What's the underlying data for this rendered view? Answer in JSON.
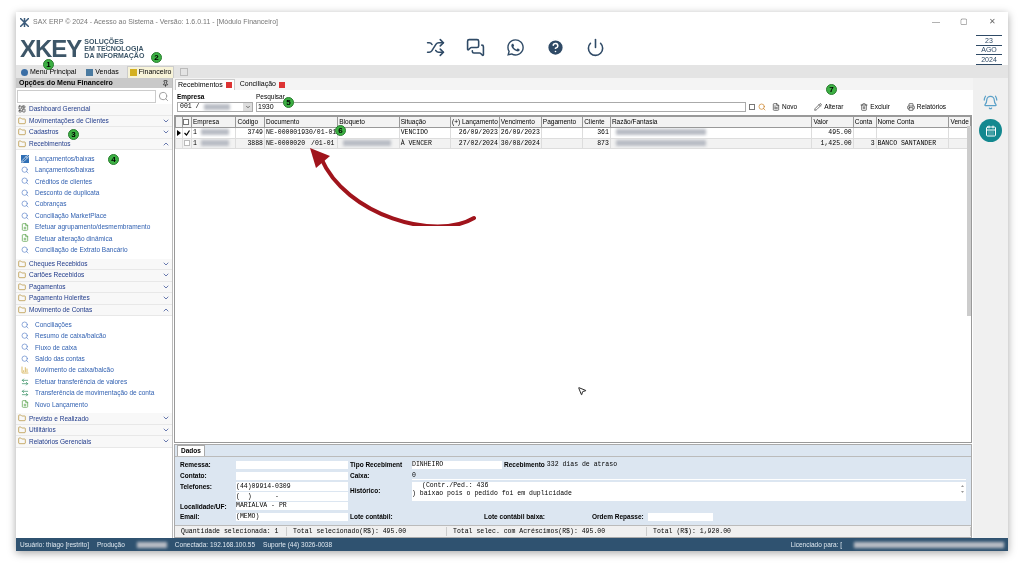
{
  "window": {
    "title": "SAX ERP © 2024 - Acesso ao Sistema - Versão: 1.6.0.11 - [Módulo Financeiro]",
    "controls": [
      "—",
      "▢",
      "✕"
    ]
  },
  "logo": {
    "mark": "XKEY",
    "tagline": [
      "SOLUÇÕES",
      "EM TECNOLOGIA",
      "DA INFORMAÇÃO"
    ]
  },
  "date": {
    "day": "23",
    "month": "AGO",
    "year": "2024"
  },
  "module_tabs": [
    {
      "label": "Menu Principal",
      "selected": false
    },
    {
      "label": "Vendas",
      "selected": false
    },
    {
      "label": "Financeiro",
      "selected": true
    }
  ],
  "sidebar": {
    "title": "Opções do Menu Financeiro",
    "items": [
      {
        "label": "Dashboard Gerencial",
        "kind": "link"
      },
      {
        "label": "Movimentações de Clientes",
        "kind": "section",
        "expanded": false
      },
      {
        "label": "Cadastros",
        "kind": "section",
        "expanded": false
      },
      {
        "label": "Recebimentos",
        "kind": "section",
        "expanded": true,
        "children": [
          {
            "label": "Lançamentos/baixas",
            "kind": "edit"
          },
          {
            "label": "Lançamentos/baixas",
            "kind": "search"
          },
          {
            "label": "Créditos de clientes",
            "kind": "search"
          },
          {
            "label": "Desconto de duplicata",
            "kind": "search"
          },
          {
            "label": "Cobranças",
            "kind": "search"
          },
          {
            "label": "Conciliação MarketPlace",
            "kind": "search"
          },
          {
            "label": "Efetuar agrupamento/desmembramento",
            "kind": "doc"
          },
          {
            "label": "Efetuar alteração dinâmica",
            "kind": "doc"
          },
          {
            "label": "Conciliação de Extrato Bancário",
            "kind": "search"
          }
        ]
      },
      {
        "label": "Cheques Recebidos",
        "kind": "section",
        "expanded": false
      },
      {
        "label": "Cartões Recebidos",
        "kind": "section",
        "expanded": false
      },
      {
        "label": "Pagamentos",
        "kind": "section",
        "expanded": false
      },
      {
        "label": "Pagamento Holerites",
        "kind": "section",
        "expanded": false
      },
      {
        "label": "Movimento de Contas",
        "kind": "section",
        "expanded": true,
        "children": [
          {
            "label": "Conciliações",
            "kind": "search"
          },
          {
            "label": "Resumo de caixa/balcão",
            "kind": "search"
          },
          {
            "label": "Fluxo de caixa",
            "kind": "search"
          },
          {
            "label": "Saldo das contas",
            "kind": "search"
          },
          {
            "label": "Movimento de caixa/balcão",
            "kind": "chart"
          },
          {
            "label": "Efetuar transferência de valores",
            "kind": "transfer"
          },
          {
            "label": "Transferência de movimentação de conta",
            "kind": "transfer"
          },
          {
            "label": "Novo Lançamento",
            "kind": "doc"
          }
        ]
      },
      {
        "label": "Previsto e Realizado",
        "kind": "section",
        "expanded": false
      },
      {
        "label": "Utilitários",
        "kind": "section",
        "expanded": false
      },
      {
        "label": "Relatórios Gerenciais",
        "kind": "section",
        "expanded": false
      }
    ]
  },
  "doc_tabs": [
    {
      "label": "Recebimentos",
      "selected": true
    },
    {
      "label": "Conciliação",
      "selected": false
    }
  ],
  "filters": {
    "empresa_label": "Empresa",
    "empresa_value": "001 /",
    "search_label": "Pesquisar",
    "search_value": "1930",
    "exact_checked": false
  },
  "toolbar": [
    "Novo",
    "Alterar",
    "Excluir",
    "Relatórios"
  ],
  "table": {
    "columns": [
      "Empresa",
      "Código",
      "Documento",
      "Bloqueto",
      "Situação",
      "(+) Lançamento",
      "Vencimento",
      "Pagamento",
      "Cliente",
      "Razão/Fantasia",
      "Valor",
      "Conta",
      "Nome Conta",
      "Vende"
    ],
    "all_checked": false,
    "rows": [
      {
        "current": true,
        "checked": true,
        "empresa": "1",
        "codigo": "3749",
        "documento": "NE-000001930/01-01",
        "documento_end": "",
        "situacao": "VENCIDO",
        "lancamento": "26/09/2023",
        "vencimento": "26/09/2023",
        "cliente": "361",
        "valor": "495.00",
        "conta": "",
        "nome_conta": ""
      },
      {
        "current": false,
        "checked": false,
        "empresa": "1",
        "codigo": "3888",
        "documento": "NE-0000020",
        "documento_end": "/01-01",
        "situacao": "À VENCER",
        "lancamento": "27/02/2024",
        "vencimento": "30/08/2024",
        "cliente": "873",
        "valor": "1,425.00",
        "conta": "3",
        "nome_conta": "BANCO SANTANDER"
      }
    ]
  },
  "details": {
    "tab": "Dados",
    "remessa_label": "Remessa:",
    "contato_label": "Contato:",
    "telefones_label": "Telefones:",
    "telefone1": "(44)09914-0309",
    "telefone2": "(  )      -",
    "localidade_label": "Localidade/UF:",
    "localidade": "MARIALVA - PR",
    "email_label": "Email:",
    "email": "(MEMO)",
    "tipo_label": "Tipo Recebiment",
    "tipo": "DINHEIRO",
    "caixa_label": "Caixa:",
    "caixa": "0",
    "historico_label": "Histórico:",
    "historico": [
      "(Contr./Ped.: 436",
      ") baixao pois o pedido foi em duplicidade"
    ],
    "lote_label": "Lote contábil:",
    "lote_baixa_label": "Lote contábil baixa:",
    "ordem_label": "Ordem Repasse:",
    "recebimento_label": "Recebimento",
    "recebimento": "332 dias de atraso"
  },
  "totals": [
    "Quantidade selecionada: 1",
    "Total selecionado(R$): 495.00",
    "Total selec. com Acréscimos(R$): 495.00",
    "Total (R$): 1,920.00"
  ],
  "status_bar": {
    "user": "Usuário: thiago [restrito]",
    "env": "Produção",
    "connection": "Conectada: 192.168.100.55",
    "support": "Suporte (44) 3026-0038",
    "license": "Licenciado para: ["
  },
  "annotations": [
    "1",
    "2",
    "3",
    "4",
    "5",
    "6",
    "7"
  ]
}
